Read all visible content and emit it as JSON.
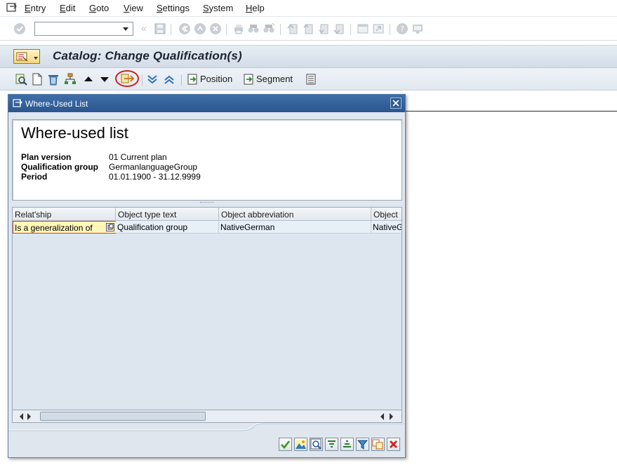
{
  "menu": {
    "items": [
      {
        "label": "Entry",
        "u": "E",
        "rest": "ntry"
      },
      {
        "label": "Edit",
        "u": "E",
        "rest": "dit"
      },
      {
        "label": "Goto",
        "u": "G",
        "rest": "oto"
      },
      {
        "label": "View",
        "u": "V",
        "rest": "iew"
      },
      {
        "label": "Settings",
        "u": "S",
        "rest": "ettings"
      },
      {
        "label": "System",
        "u": "S",
        "rest": "ystem"
      },
      {
        "label": "Help",
        "u": "H",
        "rest": "elp"
      }
    ]
  },
  "toolbar": {
    "command_field_value": "",
    "nav_back_glyph": "«"
  },
  "title": {
    "text": "Catalog: Change Qualification(s)"
  },
  "app_toolbar": {
    "position_label": "Position",
    "segment_label": "Segment"
  },
  "dialog": {
    "title": "Where-Used List",
    "heading": "Where-used list",
    "fields": [
      {
        "label": "Plan version",
        "value": "01 Current plan"
      },
      {
        "label": "Qualification group",
        "value": "GermanlanguageGroup"
      },
      {
        "label": "Period",
        "value": "01.01.1900 - 31.12.9999"
      }
    ],
    "table": {
      "columns": [
        "Relat'ship",
        "Object type text",
        "Object abbreviation",
        "Object"
      ],
      "rows": [
        [
          "Is a generalization of",
          "Qualification group",
          "NativeGerman",
          "NativeG"
        ]
      ]
    }
  },
  "colors": {
    "title_bar": "#2b5690",
    "selected_cell": "#fff7b8",
    "highlight_circle": "#d42020"
  }
}
